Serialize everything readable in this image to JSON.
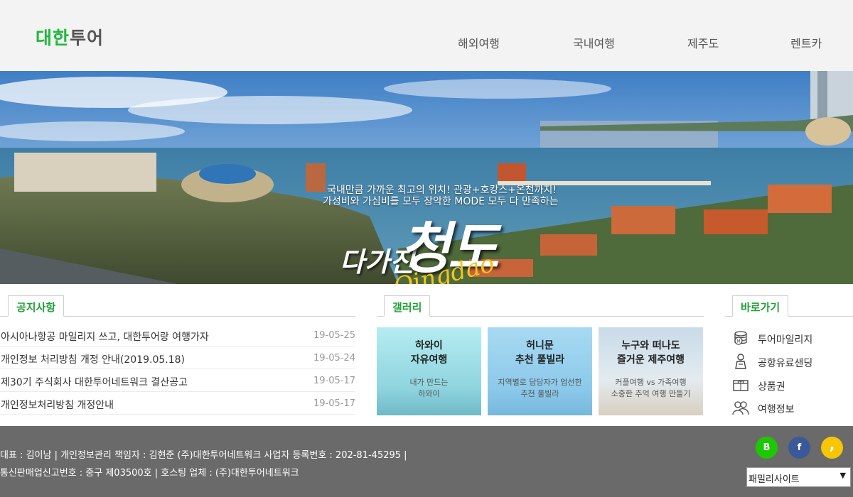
{
  "header": {
    "logo_part1": "대한",
    "logo_part2": "투어",
    "nav": [
      "해외여행",
      "국내여행",
      "제주도",
      "렌트카"
    ]
  },
  "hero": {
    "line1": "국내만큼 가까운 최고의 위치! 관광+호캉스+온천까지!",
    "line2": "가성비와 가심비를 모두 장악한 MODE 모두 다 만족하는",
    "sub": "다가진",
    "main": "청도",
    "script": "Qingdao"
  },
  "notice": {
    "tab": "공지사항",
    "items": [
      {
        "title": "아시아나항공 마일리지 쓰고, 대한투어랑 여행가자",
        "date": "19-05-25"
      },
      {
        "title": "개인정보 처리방침 개정 안내(2019.05.18)",
        "date": "19-05-24"
      },
      {
        "title": "제30기 주식회사 대한투어네트워크 결산공고",
        "date": "19-05-17"
      },
      {
        "title": "개인정보처리방침 개정안내",
        "date": "19-05-17"
      }
    ]
  },
  "gallery": {
    "tab": "갤러리",
    "items": [
      {
        "title1": "하와이",
        "title2": "자유여행",
        "desc1": "내가 만드는",
        "desc2": "하와이"
      },
      {
        "title1": "허니문",
        "title2": "추천 풀빌라",
        "desc1": "지역별로 담당자가 엄선한",
        "desc2": "추천 풀빌라"
      },
      {
        "title1": "누구와 떠나도",
        "title2": "즐거운 제주여행",
        "desc1": "커플여행 vs 가족여행",
        "desc2": "소중한 추억 여행 만들기"
      }
    ]
  },
  "quick": {
    "tab": "바로가기",
    "items": [
      {
        "label": "투어마일리지",
        "icon": "coin-stack-icon"
      },
      {
        "label": "공항유료샌딩",
        "icon": "person-icon"
      },
      {
        "label": "상품권",
        "icon": "gift-card-icon"
      },
      {
        "label": "여행정보",
        "icon": "people-icon"
      }
    ]
  },
  "footer": {
    "line1": "대표 : 김이남 | 개인정보관리 책임자 : 김현준 (주)대한투어네트워크 사업자 등록번호 : 202-81-45295 |",
    "line2": "통신판매업신고번호 : 중구 제03500호 | 호스팅 업체 : (주)대한투어네트워크",
    "sns": [
      {
        "label": "B",
        "color": "#1ec800"
      },
      {
        "label": "f",
        "color": "#3b5998"
      },
      {
        "label": ",",
        "color": "#f7c600"
      }
    ],
    "family_select": "패밀리사이트"
  },
  "colors": {
    "brand_green": "#21b83b",
    "footer_bg": "#6a6a6a",
    "header_bg": "#f3f3f3"
  }
}
